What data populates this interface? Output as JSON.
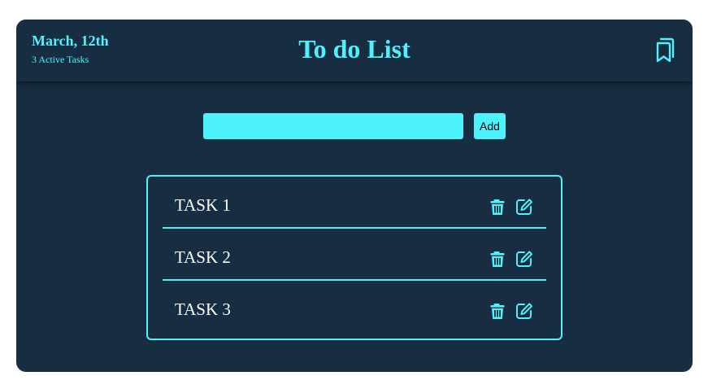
{
  "header": {
    "date": "March, 12th",
    "active_tasks": "3 Active Tasks",
    "title": "To do List",
    "bookmark_icon": "bookmarks-icon"
  },
  "new_task": {
    "value": "",
    "placeholder": "",
    "add_label": "Add"
  },
  "tasks": [
    {
      "label": "TASK 1"
    },
    {
      "label": "TASK 2"
    },
    {
      "label": "TASK 3"
    }
  ],
  "icons": {
    "delete": "trash-icon",
    "edit": "edit-icon"
  },
  "colors": {
    "background": "#172d42",
    "accent": "#4ef2fd",
    "text": "#ffffff"
  }
}
